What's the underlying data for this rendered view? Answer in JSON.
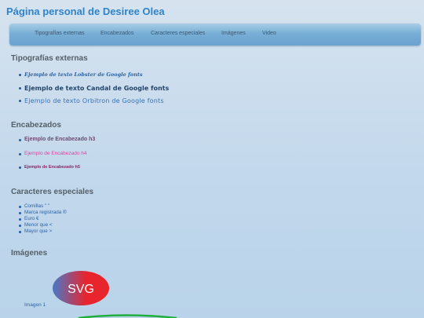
{
  "header": {
    "title": "Página personal de Desiree Olea"
  },
  "nav": {
    "items": [
      {
        "label": "Tipografías externas"
      },
      {
        "label": "Encabezados"
      },
      {
        "label": "Caracteres especiales"
      },
      {
        "label": "Imágenes"
      },
      {
        "label": "Video"
      }
    ]
  },
  "sections": {
    "tipografias": {
      "heading": "Tipografías externas",
      "lobster": "Ejemplo de texto Lobster de Google fonts",
      "candal": "Ejemplo de texto Candal de Google fonts",
      "orbitron": "Ejemplo de texto Orbitron de Google fonts"
    },
    "encabezados": {
      "heading": "Encabezados",
      "h3": "Ejemplo de Encabezado h3",
      "h4": "Ejemplo de Encabezado h4",
      "h5": "Ejemplo de Encabezado h5"
    },
    "caracteres": {
      "heading": "Caracteres especiales",
      "items": [
        "Comillas \"   \"",
        "Marca registrada ®",
        "Euro €",
        "Menor que <",
        "Mayor que >"
      ]
    },
    "imagenes": {
      "heading": "Imágenes",
      "svg_text": "SVG",
      "caption": "Imagen 1"
    }
  },
  "colors": {
    "title": "#2f83c8",
    "navbar": "#78aed6",
    "h4": "#d8479d",
    "svg_red": "#e8242c",
    "svg_blue": "#4a78c8"
  }
}
